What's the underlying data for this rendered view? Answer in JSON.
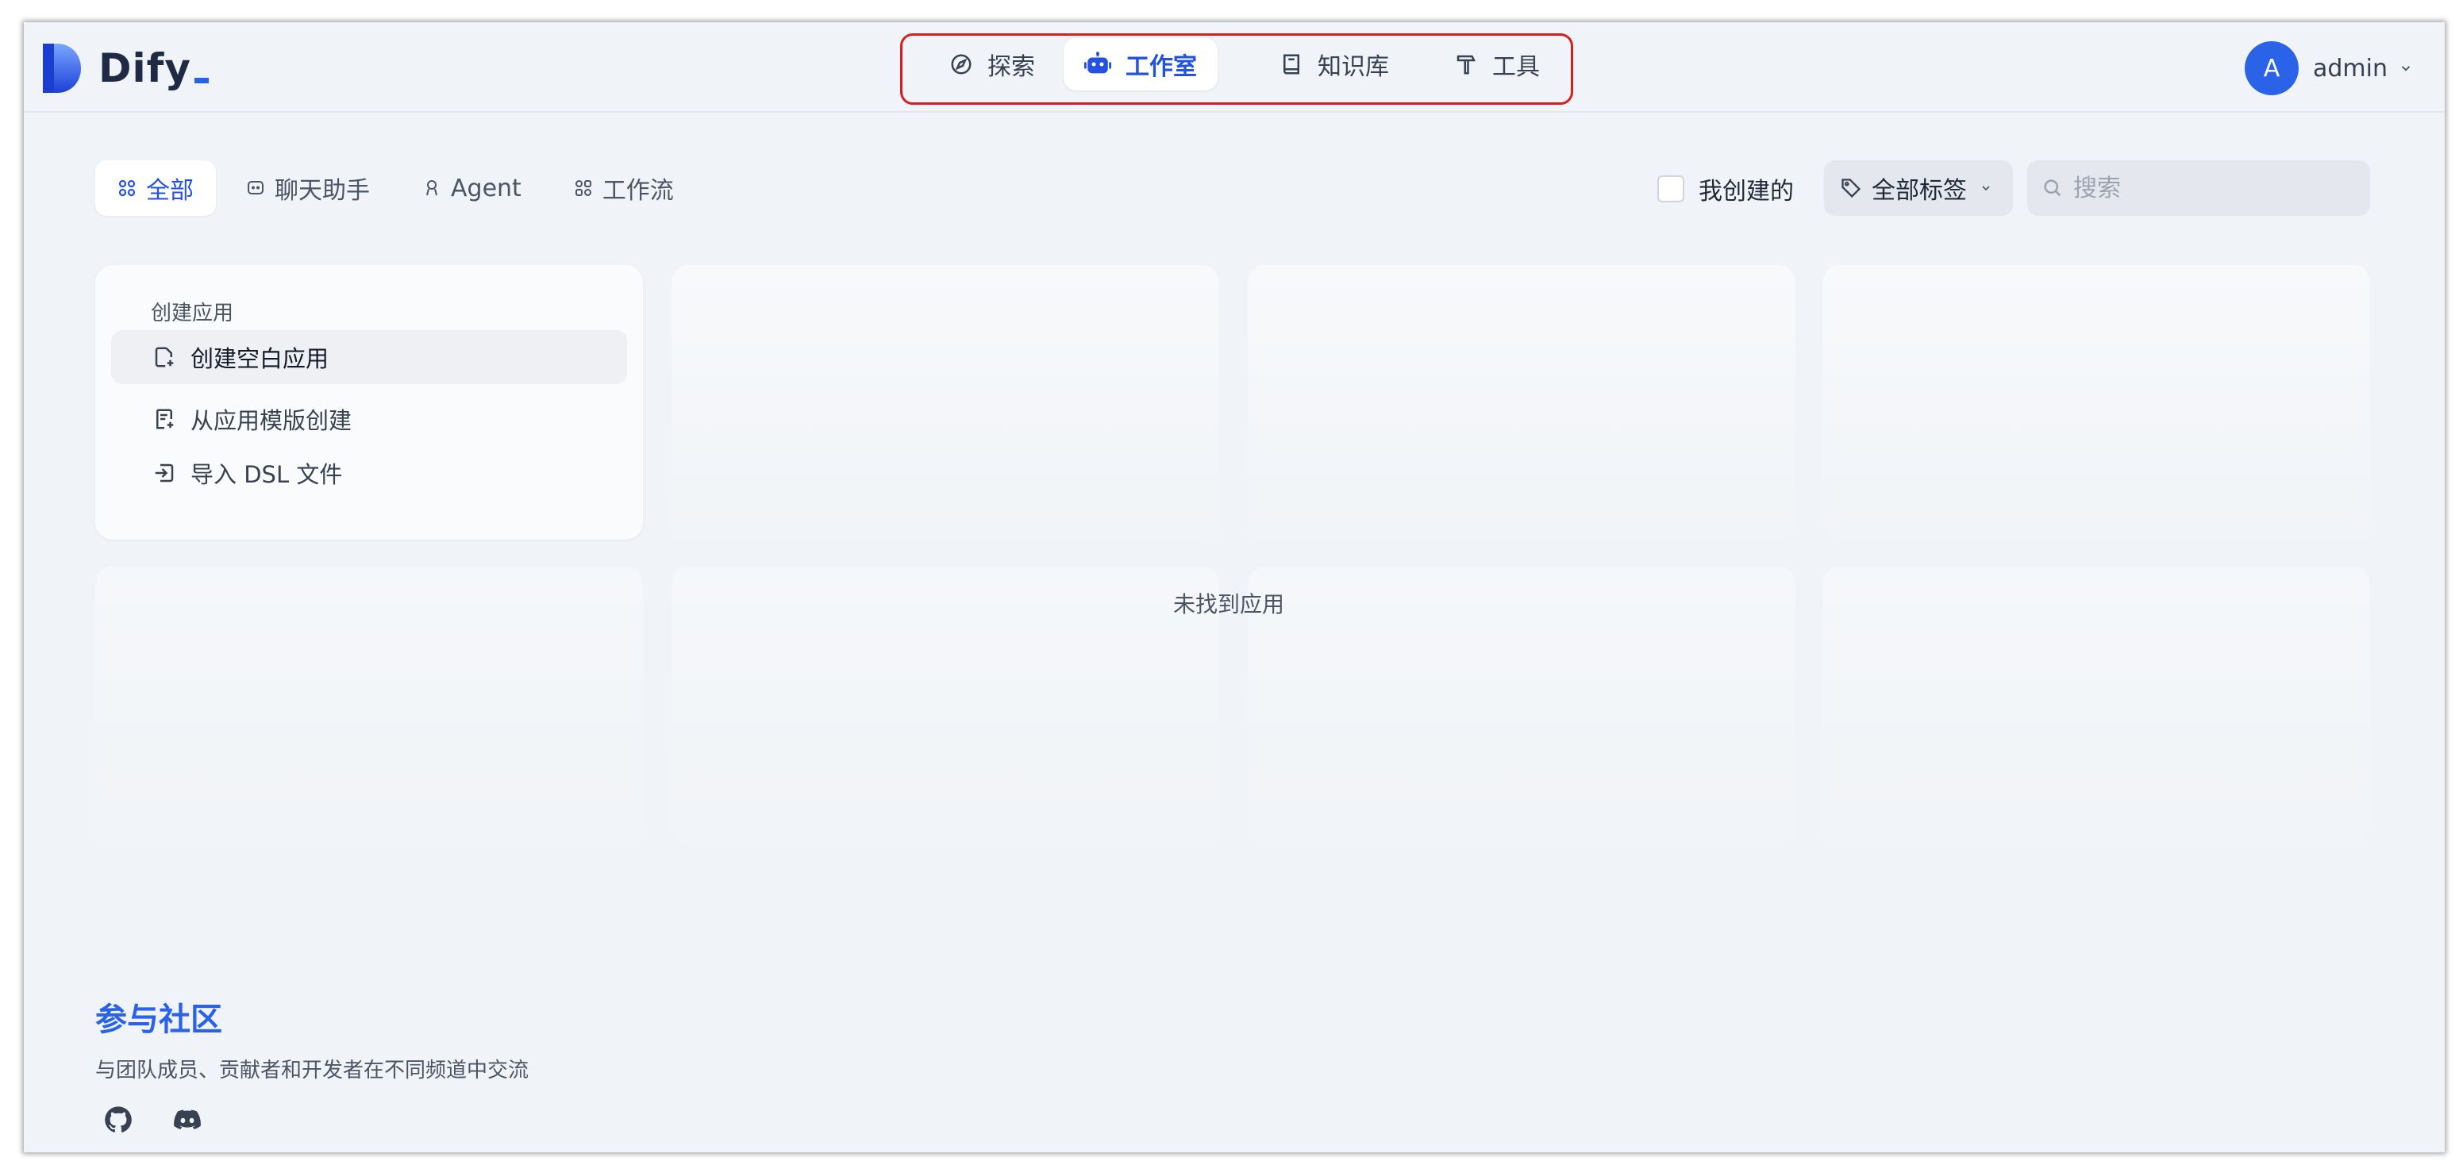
{
  "app": {
    "logo_text": "Dify"
  },
  "nav": {
    "items": [
      {
        "label": "探索",
        "icon": "compass-icon"
      },
      {
        "label": "工作室",
        "icon": "robot-icon",
        "active": true
      },
      {
        "label": "知识库",
        "icon": "book-icon"
      },
      {
        "label": "工具",
        "icon": "hammer-icon"
      }
    ]
  },
  "user": {
    "initial": "A",
    "name": "admin"
  },
  "filters": {
    "tabs": [
      {
        "label": "全部",
        "active": true
      },
      {
        "label": "聊天助手"
      },
      {
        "label": "Agent"
      },
      {
        "label": "工作流"
      }
    ],
    "created_by_me": "我创建的",
    "tags_label": "全部标签",
    "search_placeholder": "搜索"
  },
  "create_card": {
    "title": "创建应用",
    "items": [
      {
        "label": "创建空白应用"
      },
      {
        "label": "从应用模版创建"
      },
      {
        "label": "导入 DSL 文件"
      }
    ]
  },
  "empty_text": "未找到应用",
  "community": {
    "title": "参与社区",
    "subtitle": "与团队成员、贡献者和开发者在不同频道中交流"
  },
  "colors": {
    "accent": "#2352e0",
    "highlight_box": "#d71f1f",
    "background": "#f0f3f7"
  }
}
